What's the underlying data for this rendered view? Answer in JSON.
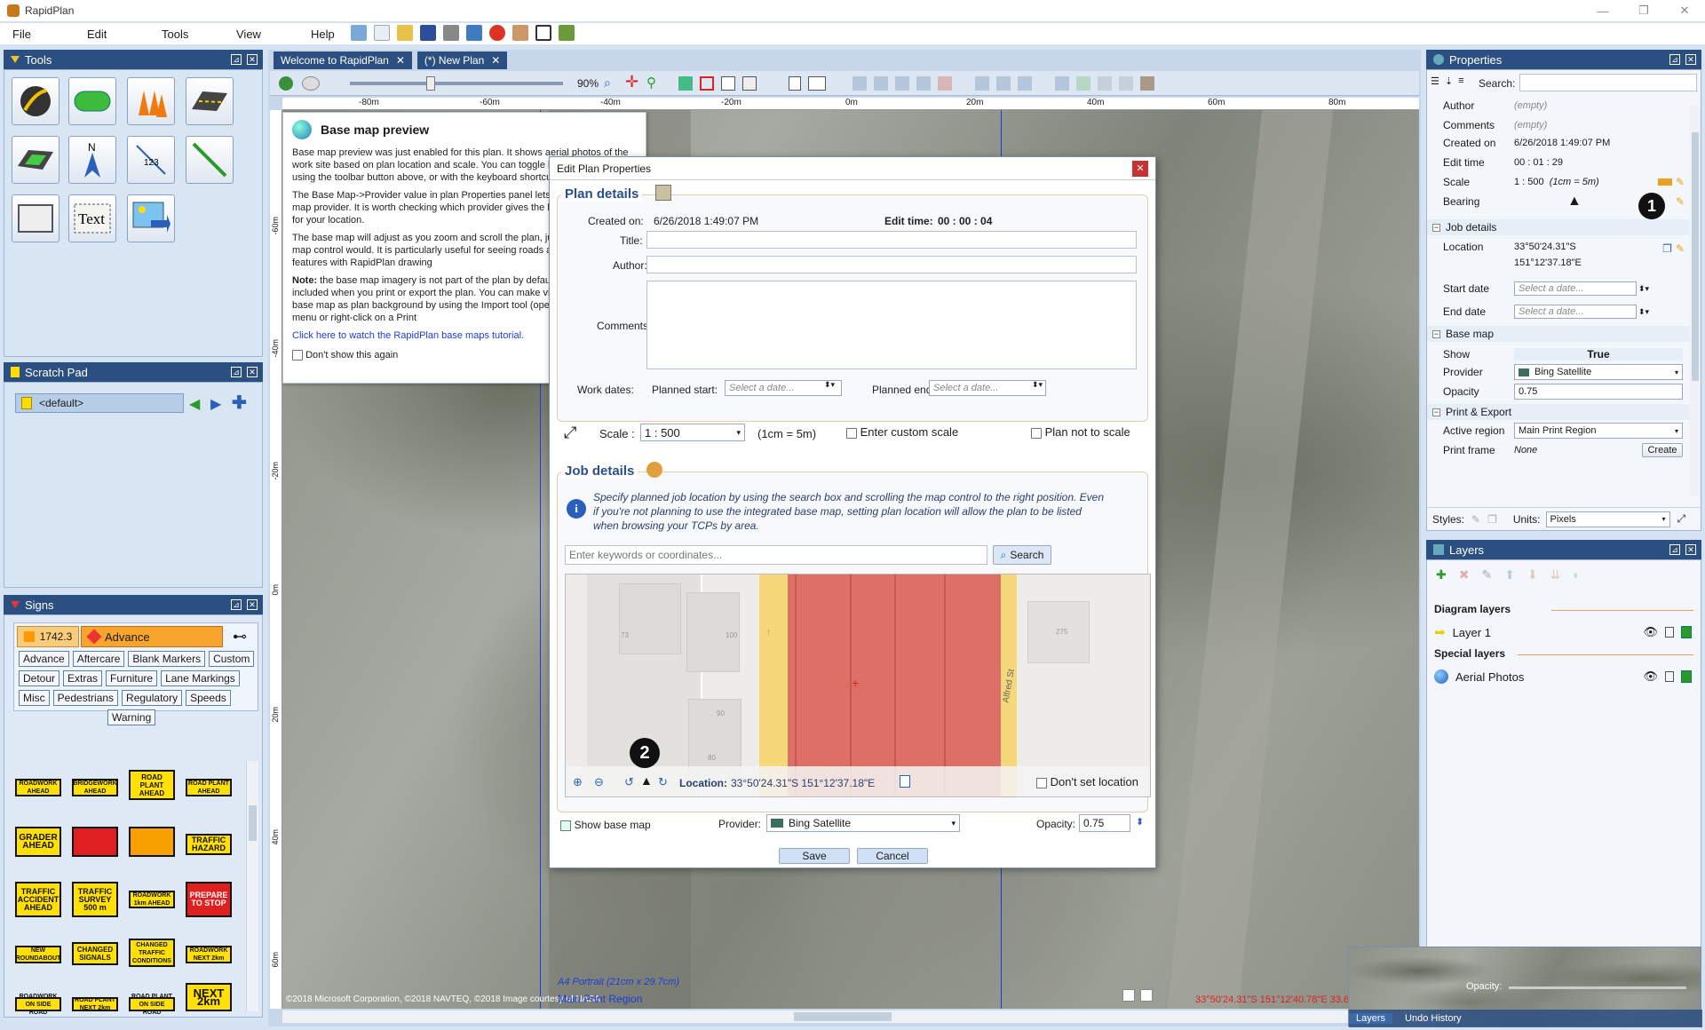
{
  "app": {
    "title": "RapidPlan",
    "window_controls": [
      "—",
      "❐",
      "✕"
    ]
  },
  "menu": [
    "File",
    "Edit",
    "Tools",
    "View",
    "Help"
  ],
  "tools_panel": {
    "title": "Tools"
  },
  "scratch_pad": {
    "title": "Scratch Pad",
    "item": "<default>"
  },
  "signs_panel": {
    "title": "Signs",
    "standard": "1742.3",
    "category": "Advance",
    "tabs": [
      "Advance",
      "Aftercare",
      "Blank Markers",
      "Custom",
      "Detour",
      "Extras",
      "Furniture",
      "Lane Markings",
      "Misc",
      "Pedestrians",
      "Regulatory",
      "Speeds",
      "Warning"
    ],
    "signs": [
      "ROADWORK AHEAD",
      "BRIDGEWORK AHEAD",
      "ROAD PLANT AHEAD",
      "ROAD PLANT AHEAD",
      "GRADER AHEAD",
      "",
      "",
      "TRAFFIC HAZARD",
      "TRAFFIC ACCIDENT AHEAD",
      "TRAFFIC SURVEY 500 m",
      "ROADWORK 1km AHEAD",
      "PREPARE TO STOP",
      "NEW ROUNDABOUT",
      "CHANGED SIGNALS",
      "CHANGED TRAFFIC CONDITIONS",
      "ROADWORK NEXT 2km",
      "ROADWORK ON SIDE ROAD",
      "ROAD PLANT NEXT 2km",
      "ROAD PLANT ON SIDE ROAD",
      "NEXT 2km"
    ]
  },
  "doc_tabs": [
    {
      "label": "Welcome to RapidPlan"
    },
    {
      "label": "(*) New Plan"
    }
  ],
  "canvas_toolbar": {
    "zoom": "90%"
  },
  "ruler": {
    "h_labels": [
      "-80m",
      "-60m",
      "-40m",
      "-20m",
      "0m",
      "20m",
      "40m",
      "60m",
      "80m"
    ],
    "v_labels": [
      "-60m",
      "-40m",
      "-20m",
      "0m",
      "20m",
      "40m",
      "60m"
    ]
  },
  "preview_popup": {
    "title": "Base map preview",
    "p1": "Base map preview was just enabled for this plan. It shows aerial photos of the work site based on plan location and scale. You can toggle base map visibility using the toolbar button above, or with the keyboard shortcut.",
    "p2": "The Base Map->Provider value in plan Properties panel lets you choose the map provider. It is worth checking which provider gives the best quality maps for your location.",
    "p3": "The base map will adjust as you zoom and scroll the plan, just like a web-based map control would. It is particularly useful for seeing roads and other site features with RapidPlan drawing",
    "note_label": "Note:",
    "p4": " the base map imagery is not part of the plan by default and will not be included when you print or export the plan. You can make visible parts of the base map as plan background by using the Import tool (open Tools->Import menu or right-click on a Print",
    "link": "Click here to watch the RapidPlan base maps tutorial.",
    "dont_show": "Don't show this again"
  },
  "dialog": {
    "title": "Edit Plan Properties",
    "plan_details": "Plan details",
    "created_on_label": "Created on:",
    "created_on": "6/26/2018 1:49:07 PM",
    "edit_time_label": "Edit time:",
    "edit_time": "00 : 00 : 04",
    "title_label": "Title:",
    "author_label": "Author:",
    "comments_label": "Comments:",
    "work_dates_label": "Work dates:",
    "planned_start_label": "Planned start:",
    "planned_end_label": "Planned end:",
    "date_placeholder": "Select a date...",
    "scale_label": "Scale :",
    "scale_value": "1 : 500",
    "scale_note": "(1cm = 5m)",
    "custom_scale": "Enter custom scale",
    "not_to_scale": "Plan not to scale",
    "job_details": "Job details",
    "info": "Specify planned job location by using the search box and scrolling the map control to the right position. Even if you're not planning to use the integrated base map, setting plan location will allow the plan to be listed when browsing your TCPs by area.",
    "search_placeholder": "Enter keywords or coordinates...",
    "search_button": "Search",
    "map_numbers": [
      "73",
      "100",
      "275",
      "90",
      "80"
    ],
    "street": "Alfred St",
    "marker": "2",
    "location_label": "Location:",
    "location_value": "33°50'24.31\"S  151°12'37.18\"E",
    "dont_set_location": "Don't set location",
    "show_base_map": "Show base map",
    "provider_label": "Provider:",
    "provider_value": "Bing Satellite",
    "opacity_label": "Opacity:",
    "opacity_value": "0.75",
    "save": "Save",
    "cancel": "Cancel"
  },
  "map_footer": {
    "attribution": "©2018 Microsoft Corporation, ©2018 NAVTEQ, ©2018 Image courtesy of NASA",
    "page_label": "A4 Portrait (21cm x 29.7cm)",
    "region_label": "Main Print Region",
    "coords": "33°50'24.31\"S 151°12'40.78\"E 33.67m 2.04m"
  },
  "properties": {
    "title": "Properties",
    "search_label": "Search:",
    "author_label": "Author",
    "author": "(empty)",
    "comments_label": "Comments",
    "comments": "(empty)",
    "created_label": "Created on",
    "created": "6/26/2018 1:49:07 PM",
    "edit_label": "Edit time",
    "edit": "00 : 01 : 29",
    "scale_label": "Scale",
    "scale": "1 : 500",
    "scale_note": "(1cm = 5m)",
    "bearing_label": "Bearing",
    "marker": "1",
    "job_section": "Job details",
    "location_label": "Location",
    "location_1": "33°50'24.31\"S",
    "location_2": "151°12'37.18\"E",
    "start_label": "Start date",
    "end_label": "End date",
    "date_placeholder": "Select a date...",
    "basemap_section": "Base map",
    "show_label": "Show",
    "show": "True",
    "provider_label": "Provider",
    "provider": "Bing Satellite",
    "opacity_label": "Opacity",
    "opacity": "0.75",
    "print_section": "Print & Export",
    "region_label": "Active region",
    "region": "Main Print Region",
    "frame_label": "Print frame",
    "frame": "None",
    "create": "Create",
    "styles_label": "Styles:",
    "units_label": "Units:",
    "units": "Pixels"
  },
  "layers": {
    "title": "Layers",
    "diagram_label": "Diagram layers",
    "layer1": "Layer 1",
    "special_label": "Special layers",
    "aerial": "Aerial Photos",
    "opacity_label": "Opacity:",
    "tab_layers": "Layers",
    "tab_undo": "Undo History"
  }
}
